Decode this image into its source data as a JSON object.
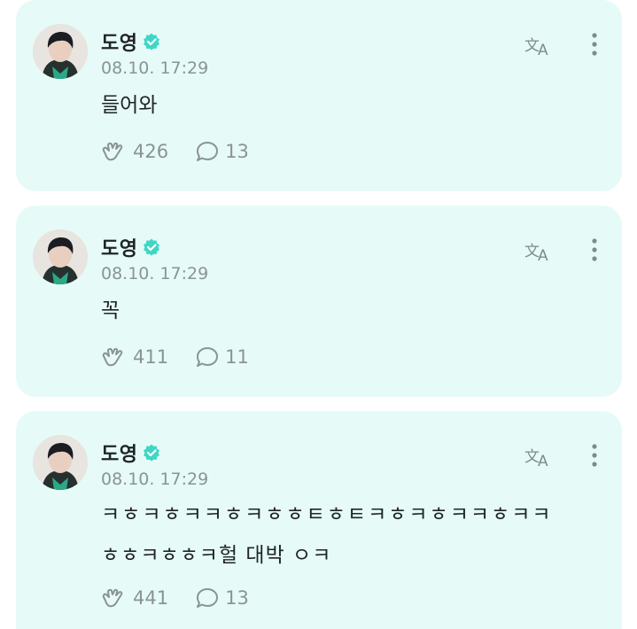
{
  "posts": [
    {
      "author": "도영",
      "time": "08.10. 17:29",
      "lines": [
        "들어와"
      ],
      "likes": "426",
      "comments": "13"
    },
    {
      "author": "도영",
      "time": "08.10. 17:29",
      "lines": [
        "꼭"
      ],
      "likes": "411",
      "comments": "11"
    },
    {
      "author": "도영",
      "time": "08.10. 17:29",
      "lines": [
        "ㅋㅎㅋㅎㅋㅋㅎㅋㅎㅎㅌㅎㅌㅋㅎㅋㅎㅋㅋㅎㅋㅋ",
        "ㅎㅎㅋㅎㅎㅋ헐 대박 ㅇㅋ"
      ],
      "likes": "441",
      "comments": "13"
    }
  ],
  "icons": {
    "verified": "verified-badge-icon",
    "translate": "translate-icon",
    "more": "more-vertical-icon",
    "like": "heart-hands-icon",
    "comment": "comment-bubble-icon"
  },
  "colors": {
    "card_bg": "#e6fbf7",
    "verified": "#3fd6c6",
    "muted": "#8a9494",
    "text": "#1f2426"
  }
}
